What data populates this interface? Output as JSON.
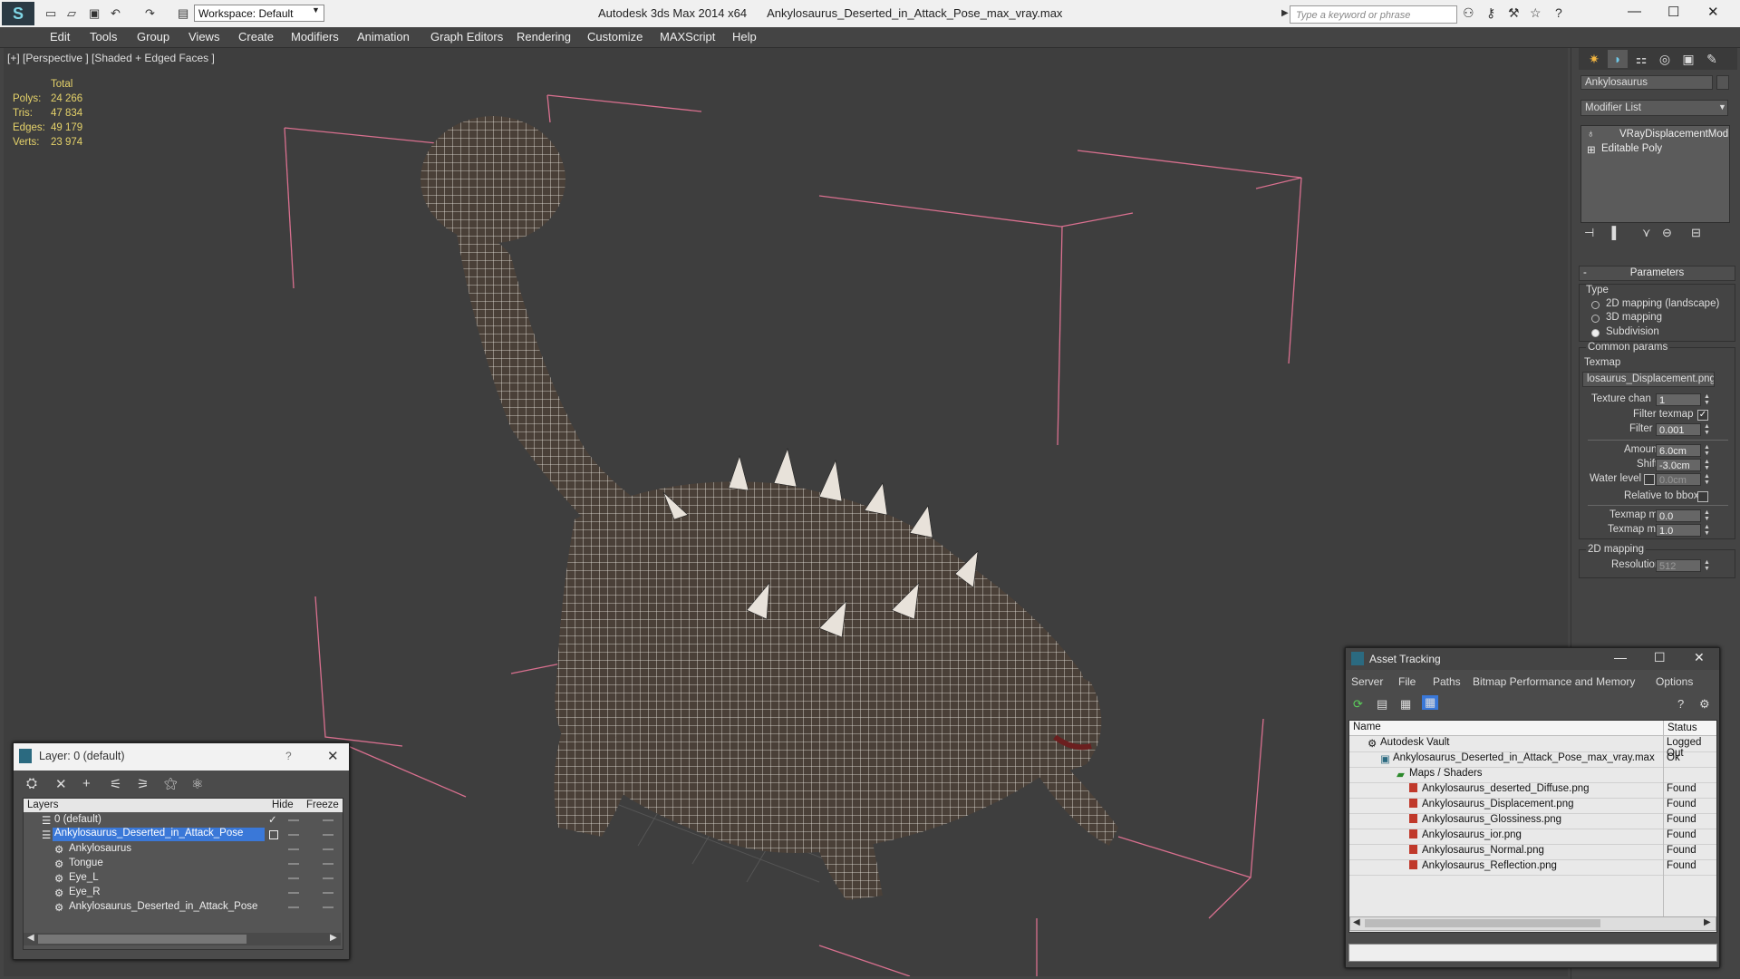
{
  "titlebar": {
    "workspace": "Workspace: Default",
    "app_name": "Autodesk 3ds Max  2014 x64",
    "file_name": "Ankylosaurus_Deserted_in_Attack_Pose_max_vray.max",
    "search_placeholder": "Type a keyword or phrase"
  },
  "menu": [
    "Edit",
    "Tools",
    "Group",
    "Views",
    "Create",
    "Modifiers",
    "Animation",
    "Graph Editors",
    "Rendering",
    "Customize",
    "MAXScript",
    "Help"
  ],
  "viewport": {
    "label": "[+] [Perspective ] [Shaded + Edged Faces ]",
    "stats": {
      "header": "Total",
      "rows": [
        {
          "label": "Polys:",
          "value": "24 266"
        },
        {
          "label": "Tris:",
          "value": "47 834"
        },
        {
          "label": "Edges:",
          "value": "49 179"
        },
        {
          "label": "Verts:",
          "value": "23 974"
        }
      ]
    }
  },
  "command_panel": {
    "object_name": "Ankylosaurus",
    "modifier_list": "Modifier List",
    "stack": [
      "VRayDisplacementMod",
      "Editable Poly"
    ],
    "rollout_title": "Parameters",
    "type_label": "Type",
    "type_options": [
      "2D mapping (landscape)",
      "3D mapping",
      "Subdivision"
    ],
    "common_params": "Common params",
    "texmap_label": "Texmap",
    "texmap_value": "losaurus_Displacement.png)",
    "texture_chan_label": "Texture chan",
    "texture_chan_value": "1",
    "filter_texmap_label": "Filter texmap",
    "filter_blur_label": "Filter blur",
    "filter_blur_value": "0.001",
    "amount_label": "Amount",
    "amount_value": "6.0cm",
    "shift_label": "Shift",
    "shift_value": "-3.0cm",
    "water_level_label": "Water level",
    "water_level_value": "0.0cm",
    "relative_bbox_label": "Relative to bbox",
    "texmap_min_label": "Texmap min",
    "texmap_min_value": "0.0",
    "texmap_max_label": "Texmap max",
    "texmap_max_value": "1.0",
    "mapping_2d_label": "2D mapping",
    "resolution_label": "Resolution",
    "resolution_value": "512"
  },
  "layer_window": {
    "title": "Layer: 0 (default)",
    "help": "?",
    "columns": [
      "Layers",
      "Hide",
      "Freeze"
    ],
    "rows": [
      "0 (default)",
      "Ankylosaurus_Deserted_in_Attack_Pose",
      "Ankylosaurus",
      "Tongue",
      "Eye_L",
      "Eye_R",
      "Ankylosaurus_Deserted_in_Attack_Pose"
    ]
  },
  "asset_window": {
    "title": "Asset Tracking",
    "menu": [
      "Server",
      "File",
      "Paths",
      "Bitmap Performance and Memory",
      "Options"
    ],
    "columns": [
      "Name",
      "Status"
    ],
    "rows": [
      {
        "name": "Autodesk Vault",
        "status": "Logged Out"
      },
      {
        "name": "Ankylosaurus_Deserted_in_Attack_Pose_max_vray.max",
        "status": "Ok"
      },
      {
        "name": "Maps / Shaders",
        "status": ""
      },
      {
        "name": "Ankylosaurus_deserted_Diffuse.png",
        "status": "Found"
      },
      {
        "name": "Ankylosaurus_Displacement.png",
        "status": "Found"
      },
      {
        "name": "Ankylosaurus_Glossiness.png",
        "status": "Found"
      },
      {
        "name": "Ankylosaurus_ior.png",
        "status": "Found"
      },
      {
        "name": "Ankylosaurus_Normal.png",
        "status": "Found"
      },
      {
        "name": "Ankylosaurus_Reflection.png",
        "status": "Found"
      }
    ]
  }
}
